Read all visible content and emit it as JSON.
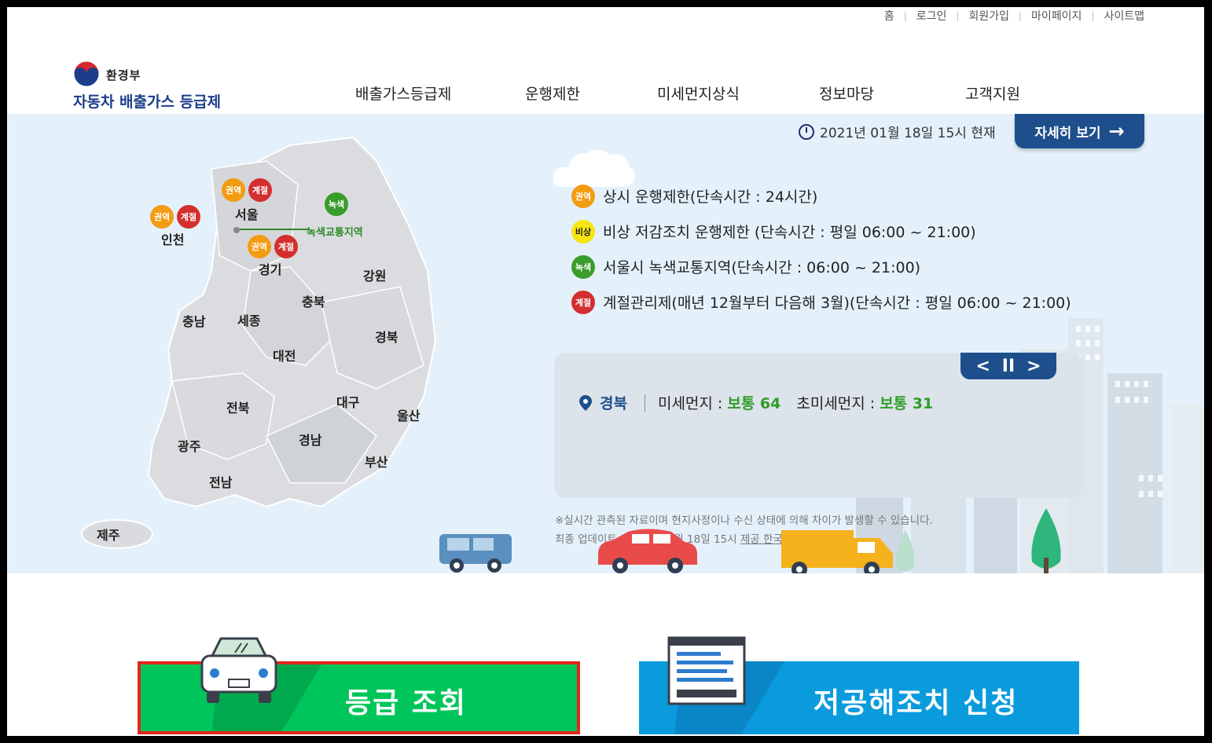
{
  "util_links": [
    "홈",
    "로그인",
    "회원가입",
    "마이페이지",
    "사이트맵"
  ],
  "logo": {
    "ministry": "환경부",
    "site_name": "자동차 배출가스 등급제"
  },
  "gnb": [
    "배출가스등급제",
    "운행제한",
    "미세먼지상식",
    "정보마당",
    "고객지원"
  ],
  "hero": {
    "timestamp": "2021년 01월 18일 15시 현재",
    "more_button": "자세히 보기",
    "map": {
      "regions": {
        "seoul": "서울",
        "incheon": "인천",
        "gyeonggi": "경기",
        "gangwon": "강원",
        "chungbuk": "충북",
        "chungnam": "충남",
        "sejong": "세종",
        "daejeon": "대전",
        "gyeongbuk": "경북",
        "jeonbuk": "전북",
        "daegu": "대구",
        "ulsan": "울산",
        "gwangju": "광주",
        "gyeongnam": "경남",
        "busan": "부산",
        "jeonnam": "전남",
        "jeju": "제주"
      },
      "green_zone_label": "녹색교통지역",
      "badge_regional": "권역",
      "badge_seasonal": "계절",
      "badge_green": "녹색"
    },
    "legend": [
      {
        "badge": "권역",
        "color": "#f39c12",
        "text": "상시 운행제한(단속시간 : 24시간)"
      },
      {
        "badge": "비상",
        "color": "#f7e512",
        "text": "비상 저감조치 운행제한 (단속시간 : 평일 06:00 ~ 21:00)"
      },
      {
        "badge": "녹색",
        "color": "#3a9c2a",
        "text": "서울시 녹색교통지역(단속시간 : 06:00 ~ 21:00)"
      },
      {
        "badge": "계절",
        "color": "#d32f2f",
        "text": "계절관리제(매년 12월부터 다음해 3월)(단속시간 : 평일 06:00 ~ 21:00)"
      }
    ],
    "air_quality": {
      "station": "경북",
      "pm10_label": "미세먼지 :",
      "pm10_value": "보통 64",
      "pm25_label": "초미세먼지 :",
      "pm25_value": "보통 31",
      "nav_prev": "<",
      "nav_pause": "II",
      "nav_next": ">"
    },
    "notice_line1": "※실시간 관측된 자료이며 현지사정이나 수신 상태에 의해 차이가 발생할 수 있습니다.",
    "notice_line2_prefix": "최종 업데이트 2021년 01월 18일 15시",
    "notice_source": "제공 한국환경공단"
  },
  "buttons": {
    "grade_lookup": "등급 조회",
    "reduction_apply": "저공해조치 신청"
  },
  "colors": {
    "brand_navy": "#1e4f8c",
    "hero_bg": "#e4f1fb",
    "grade_green": "#00c55a",
    "apply_blue": "#0a9bdd",
    "highlight_red": "#e1261c",
    "good_green": "#2e9c28"
  }
}
